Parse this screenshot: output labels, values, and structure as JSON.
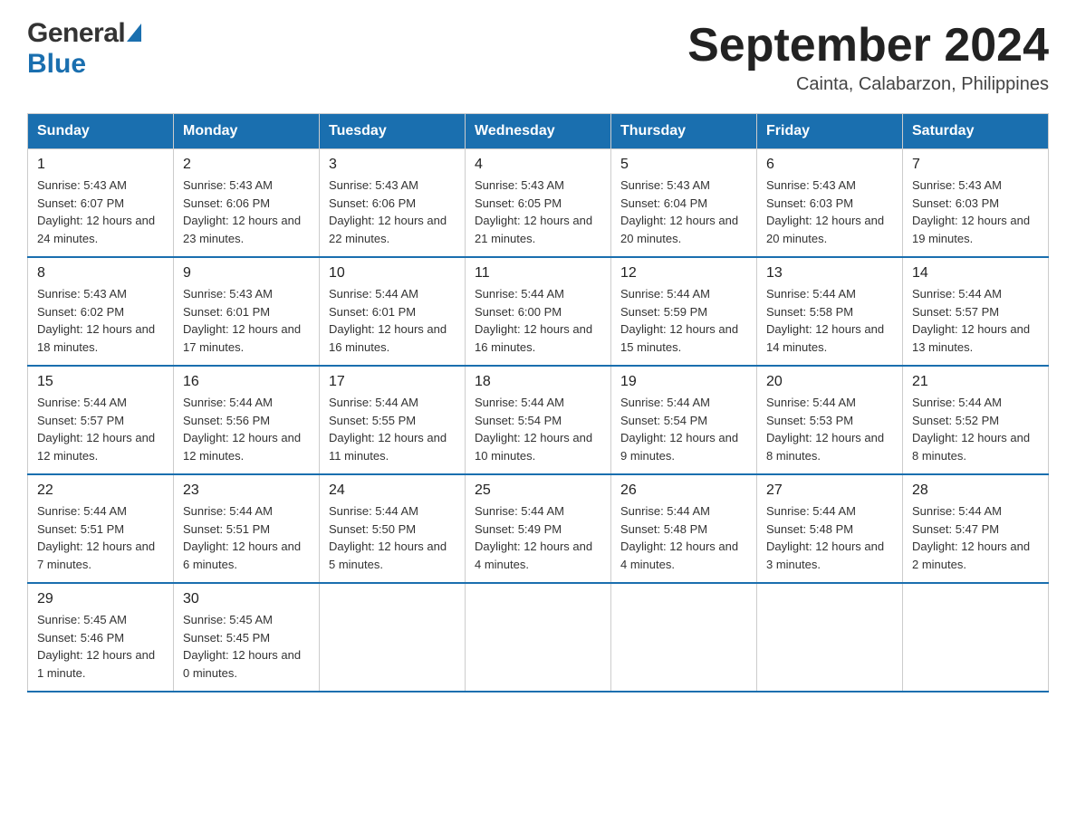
{
  "header": {
    "month_title": "September 2024",
    "location": "Cainta, Calabarzon, Philippines",
    "logo_general": "General",
    "logo_blue": "Blue"
  },
  "days_of_week": [
    "Sunday",
    "Monday",
    "Tuesday",
    "Wednesday",
    "Thursday",
    "Friday",
    "Saturday"
  ],
  "weeks": [
    [
      {
        "day": "1",
        "sunrise": "Sunrise: 5:43 AM",
        "sunset": "Sunset: 6:07 PM",
        "daylight": "Daylight: 12 hours and 24 minutes."
      },
      {
        "day": "2",
        "sunrise": "Sunrise: 5:43 AM",
        "sunset": "Sunset: 6:06 PM",
        "daylight": "Daylight: 12 hours and 23 minutes."
      },
      {
        "day": "3",
        "sunrise": "Sunrise: 5:43 AM",
        "sunset": "Sunset: 6:06 PM",
        "daylight": "Daylight: 12 hours and 22 minutes."
      },
      {
        "day": "4",
        "sunrise": "Sunrise: 5:43 AM",
        "sunset": "Sunset: 6:05 PM",
        "daylight": "Daylight: 12 hours and 21 minutes."
      },
      {
        "day": "5",
        "sunrise": "Sunrise: 5:43 AM",
        "sunset": "Sunset: 6:04 PM",
        "daylight": "Daylight: 12 hours and 20 minutes."
      },
      {
        "day": "6",
        "sunrise": "Sunrise: 5:43 AM",
        "sunset": "Sunset: 6:03 PM",
        "daylight": "Daylight: 12 hours and 20 minutes."
      },
      {
        "day": "7",
        "sunrise": "Sunrise: 5:43 AM",
        "sunset": "Sunset: 6:03 PM",
        "daylight": "Daylight: 12 hours and 19 minutes."
      }
    ],
    [
      {
        "day": "8",
        "sunrise": "Sunrise: 5:43 AM",
        "sunset": "Sunset: 6:02 PM",
        "daylight": "Daylight: 12 hours and 18 minutes."
      },
      {
        "day": "9",
        "sunrise": "Sunrise: 5:43 AM",
        "sunset": "Sunset: 6:01 PM",
        "daylight": "Daylight: 12 hours and 17 minutes."
      },
      {
        "day": "10",
        "sunrise": "Sunrise: 5:44 AM",
        "sunset": "Sunset: 6:01 PM",
        "daylight": "Daylight: 12 hours and 16 minutes."
      },
      {
        "day": "11",
        "sunrise": "Sunrise: 5:44 AM",
        "sunset": "Sunset: 6:00 PM",
        "daylight": "Daylight: 12 hours and 16 minutes."
      },
      {
        "day": "12",
        "sunrise": "Sunrise: 5:44 AM",
        "sunset": "Sunset: 5:59 PM",
        "daylight": "Daylight: 12 hours and 15 minutes."
      },
      {
        "day": "13",
        "sunrise": "Sunrise: 5:44 AM",
        "sunset": "Sunset: 5:58 PM",
        "daylight": "Daylight: 12 hours and 14 minutes."
      },
      {
        "day": "14",
        "sunrise": "Sunrise: 5:44 AM",
        "sunset": "Sunset: 5:57 PM",
        "daylight": "Daylight: 12 hours and 13 minutes."
      }
    ],
    [
      {
        "day": "15",
        "sunrise": "Sunrise: 5:44 AM",
        "sunset": "Sunset: 5:57 PM",
        "daylight": "Daylight: 12 hours and 12 minutes."
      },
      {
        "day": "16",
        "sunrise": "Sunrise: 5:44 AM",
        "sunset": "Sunset: 5:56 PM",
        "daylight": "Daylight: 12 hours and 12 minutes."
      },
      {
        "day": "17",
        "sunrise": "Sunrise: 5:44 AM",
        "sunset": "Sunset: 5:55 PM",
        "daylight": "Daylight: 12 hours and 11 minutes."
      },
      {
        "day": "18",
        "sunrise": "Sunrise: 5:44 AM",
        "sunset": "Sunset: 5:54 PM",
        "daylight": "Daylight: 12 hours and 10 minutes."
      },
      {
        "day": "19",
        "sunrise": "Sunrise: 5:44 AM",
        "sunset": "Sunset: 5:54 PM",
        "daylight": "Daylight: 12 hours and 9 minutes."
      },
      {
        "day": "20",
        "sunrise": "Sunrise: 5:44 AM",
        "sunset": "Sunset: 5:53 PM",
        "daylight": "Daylight: 12 hours and 8 minutes."
      },
      {
        "day": "21",
        "sunrise": "Sunrise: 5:44 AM",
        "sunset": "Sunset: 5:52 PM",
        "daylight": "Daylight: 12 hours and 8 minutes."
      }
    ],
    [
      {
        "day": "22",
        "sunrise": "Sunrise: 5:44 AM",
        "sunset": "Sunset: 5:51 PM",
        "daylight": "Daylight: 12 hours and 7 minutes."
      },
      {
        "day": "23",
        "sunrise": "Sunrise: 5:44 AM",
        "sunset": "Sunset: 5:51 PM",
        "daylight": "Daylight: 12 hours and 6 minutes."
      },
      {
        "day": "24",
        "sunrise": "Sunrise: 5:44 AM",
        "sunset": "Sunset: 5:50 PM",
        "daylight": "Daylight: 12 hours and 5 minutes."
      },
      {
        "day": "25",
        "sunrise": "Sunrise: 5:44 AM",
        "sunset": "Sunset: 5:49 PM",
        "daylight": "Daylight: 12 hours and 4 minutes."
      },
      {
        "day": "26",
        "sunrise": "Sunrise: 5:44 AM",
        "sunset": "Sunset: 5:48 PM",
        "daylight": "Daylight: 12 hours and 4 minutes."
      },
      {
        "day": "27",
        "sunrise": "Sunrise: 5:44 AM",
        "sunset": "Sunset: 5:48 PM",
        "daylight": "Daylight: 12 hours and 3 minutes."
      },
      {
        "day": "28",
        "sunrise": "Sunrise: 5:44 AM",
        "sunset": "Sunset: 5:47 PM",
        "daylight": "Daylight: 12 hours and 2 minutes."
      }
    ],
    [
      {
        "day": "29",
        "sunrise": "Sunrise: 5:45 AM",
        "sunset": "Sunset: 5:46 PM",
        "daylight": "Daylight: 12 hours and 1 minute."
      },
      {
        "day": "30",
        "sunrise": "Sunrise: 5:45 AM",
        "sunset": "Sunset: 5:45 PM",
        "daylight": "Daylight: 12 hours and 0 minutes."
      },
      {
        "day": "",
        "sunrise": "",
        "sunset": "",
        "daylight": ""
      },
      {
        "day": "",
        "sunrise": "",
        "sunset": "",
        "daylight": ""
      },
      {
        "day": "",
        "sunrise": "",
        "sunset": "",
        "daylight": ""
      },
      {
        "day": "",
        "sunrise": "",
        "sunset": "",
        "daylight": ""
      },
      {
        "day": "",
        "sunrise": "",
        "sunset": "",
        "daylight": ""
      }
    ]
  ]
}
